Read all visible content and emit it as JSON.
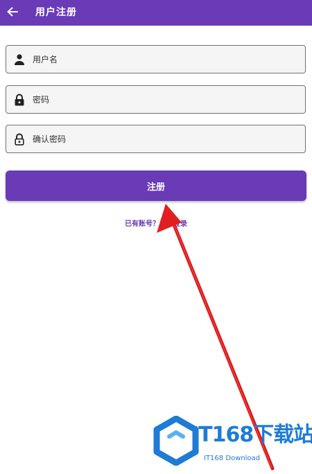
{
  "appbar": {
    "title": "用户注册",
    "back_icon": "arrow-left-icon"
  },
  "form": {
    "username": {
      "placeholder": "用户名",
      "value": "",
      "icon": "person-icon"
    },
    "password": {
      "placeholder": "密码",
      "value": "",
      "icon": "lock-icon"
    },
    "confirm_password": {
      "placeholder": "确认密码",
      "value": "",
      "icon": "lock-outline-icon"
    }
  },
  "register_button": {
    "label": "注册"
  },
  "login_link": {
    "text": "已有账号？立即登录"
  },
  "watermark": {
    "title": "IT168下载站",
    "subtitle": "IT168 Download"
  },
  "colors": {
    "primary": "#6a3bb6",
    "annotation_arrow": "#e02020",
    "watermark": "#1e7bd6"
  }
}
